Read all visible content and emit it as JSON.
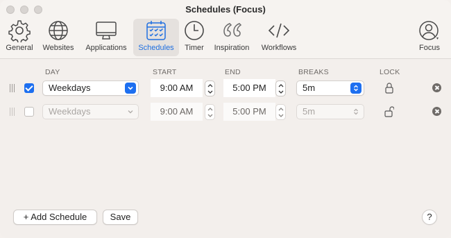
{
  "window": {
    "title": "Schedules (Focus)"
  },
  "toolbar": {
    "items": [
      {
        "label": "General",
        "icon": "gear-icon"
      },
      {
        "label": "Websites",
        "icon": "globe-icon"
      },
      {
        "label": "Applications",
        "icon": "monitor-icon"
      },
      {
        "label": "Schedules",
        "icon": "calendar-icon",
        "selected": true
      },
      {
        "label": "Timer",
        "icon": "clock-icon"
      },
      {
        "label": "Inspiration",
        "icon": "quote-icon"
      },
      {
        "label": "Workflows",
        "icon": "code-icon"
      },
      {
        "label": "Focus",
        "icon": "user-icon"
      }
    ],
    "accent": "#1f6fe0"
  },
  "columns": {
    "day": "DAY",
    "start": "START",
    "end": "END",
    "breaks": "BREAKS",
    "lock": "LOCK"
  },
  "schedules": [
    {
      "enabled": true,
      "day": "Weekdays",
      "start": "9:00 AM",
      "end": "5:00 PM",
      "breaks": "5m",
      "locked": true
    },
    {
      "enabled": false,
      "day": "Weekdays",
      "start": "9:00 AM",
      "end": "5:00 PM",
      "breaks": "5m",
      "locked": false
    }
  ],
  "footer": {
    "add_label": "+ Add Schedule",
    "save_label": "Save",
    "help_label": "?"
  }
}
